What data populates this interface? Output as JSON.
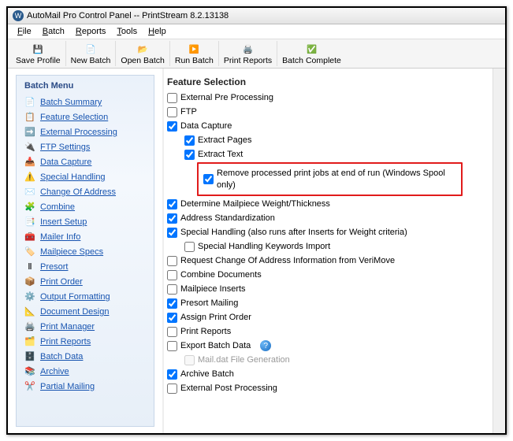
{
  "titlebar": {
    "app_icon_text": "W",
    "title": "AutoMail Pro Control Panel -- PrintStream 8.2.13138"
  },
  "menubar": {
    "file": "File",
    "batch": "Batch",
    "reports": "Reports",
    "tools": "Tools",
    "help": "Help"
  },
  "toolbar": {
    "save_profile": "Save Profile",
    "new_batch": "New Batch",
    "open_batch": "Open Batch",
    "run_batch": "Run Batch",
    "print_reports": "Print Reports",
    "batch_complete": "Batch Complete"
  },
  "sidebar": {
    "title": "Batch Menu",
    "items": [
      {
        "label": "Batch Summary",
        "icon": "📄"
      },
      {
        "label": "Feature Selection",
        "icon": "📋"
      },
      {
        "label": "External Processing",
        "icon": "➡️"
      },
      {
        "label": "FTP Settings",
        "icon": "🔌"
      },
      {
        "label": "Data Capture",
        "icon": "📥"
      },
      {
        "label": "Special Handling",
        "icon": "⚠️"
      },
      {
        "label": "Change Of Address",
        "icon": "✉️"
      },
      {
        "label": "Combine",
        "icon": "🧩"
      },
      {
        "label": "Insert Setup",
        "icon": "📑"
      },
      {
        "label": "Mailer Info",
        "icon": "🧰"
      },
      {
        "label": "Mailpiece Specs",
        "icon": "🏷️"
      },
      {
        "label": "Presort",
        "icon": "Ⅱ"
      },
      {
        "label": "Print Order",
        "icon": "📦"
      },
      {
        "label": "Output Formatting",
        "icon": "⚙️"
      },
      {
        "label": "Document Design",
        "icon": "📐"
      },
      {
        "label": "Print Manager",
        "icon": "🖨️"
      },
      {
        "label": "Print Reports",
        "icon": "🗂️"
      },
      {
        "label": "Batch Data",
        "icon": "🗄️"
      },
      {
        "label": "Archive",
        "icon": "📚"
      },
      {
        "label": "Partial Mailing",
        "icon": "✂️"
      }
    ]
  },
  "main": {
    "title": "Feature Selection",
    "rows": [
      {
        "label": "External Pre Processing",
        "checked": false,
        "indent": 0
      },
      {
        "label": "FTP",
        "checked": false,
        "indent": 0
      },
      {
        "label": "Data Capture",
        "checked": true,
        "indent": 0
      },
      {
        "label": "Extract Pages",
        "checked": true,
        "indent": 1
      },
      {
        "label": "Extract Text",
        "checked": true,
        "indent": 1
      },
      {
        "label": "Remove processed print jobs at end of run (Windows Spool only)",
        "checked": true,
        "indent": 1,
        "highlight": true
      },
      {
        "label": "Determine Mailpiece Weight/Thickness",
        "checked": true,
        "indent": 0
      },
      {
        "label": "Address Standardization",
        "checked": true,
        "indent": 0
      },
      {
        "label": "Special Handling (also runs after Inserts for Weight criteria)",
        "checked": true,
        "indent": 0
      },
      {
        "label": "Special Handling Keywords Import",
        "checked": false,
        "indent": 1
      },
      {
        "label": "Request Change Of Address Information from VeriMove",
        "checked": false,
        "indent": 0
      },
      {
        "label": "Combine Documents",
        "checked": false,
        "indent": 0
      },
      {
        "label": "Mailpiece Inserts",
        "checked": false,
        "indent": 0
      },
      {
        "label": "Presort Mailing",
        "checked": true,
        "indent": 0
      },
      {
        "label": "Assign Print Order",
        "checked": true,
        "indent": 0
      },
      {
        "label": "Print Reports",
        "checked": false,
        "indent": 0
      },
      {
        "label": "Export Batch Data",
        "checked": false,
        "indent": 0,
        "help": true
      },
      {
        "label": "Mail.dat File Generation",
        "checked": false,
        "indent": 1,
        "disabled": true
      },
      {
        "label": "Archive Batch",
        "checked": true,
        "indent": 0
      },
      {
        "label": "External Post Processing",
        "checked": false,
        "indent": 0
      }
    ]
  }
}
